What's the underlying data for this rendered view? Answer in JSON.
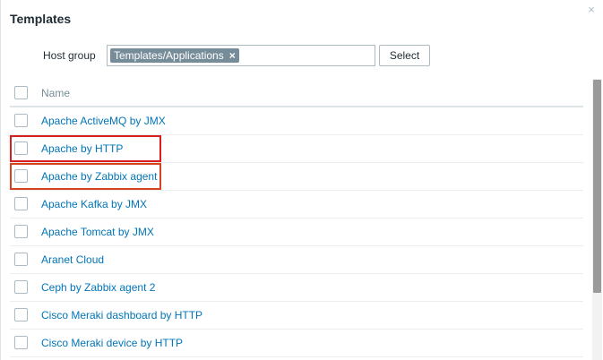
{
  "dialog": {
    "title": "Templates",
    "close_icon": "×"
  },
  "filter": {
    "host_group_label": "Host group",
    "selected_chip": "Templates/Applications",
    "chip_remove_icon": "×",
    "select_button": "Select"
  },
  "table": {
    "header_name": "Name",
    "rows": [
      "Apache ActiveMQ by JMX",
      "Apache by HTTP",
      "Apache by Zabbix agent",
      "Apache Kafka by JMX",
      "Apache Tomcat by JMX",
      "Aranet Cloud",
      "Ceph by Zabbix agent 2",
      "Cisco Meraki dashboard by HTTP",
      "Cisco Meraki device by HTTP"
    ]
  },
  "colors": {
    "link": "#0275b8",
    "highlight_1": "#d81f1f",
    "highlight_2": "#d8431f",
    "chip": "#768d99"
  }
}
